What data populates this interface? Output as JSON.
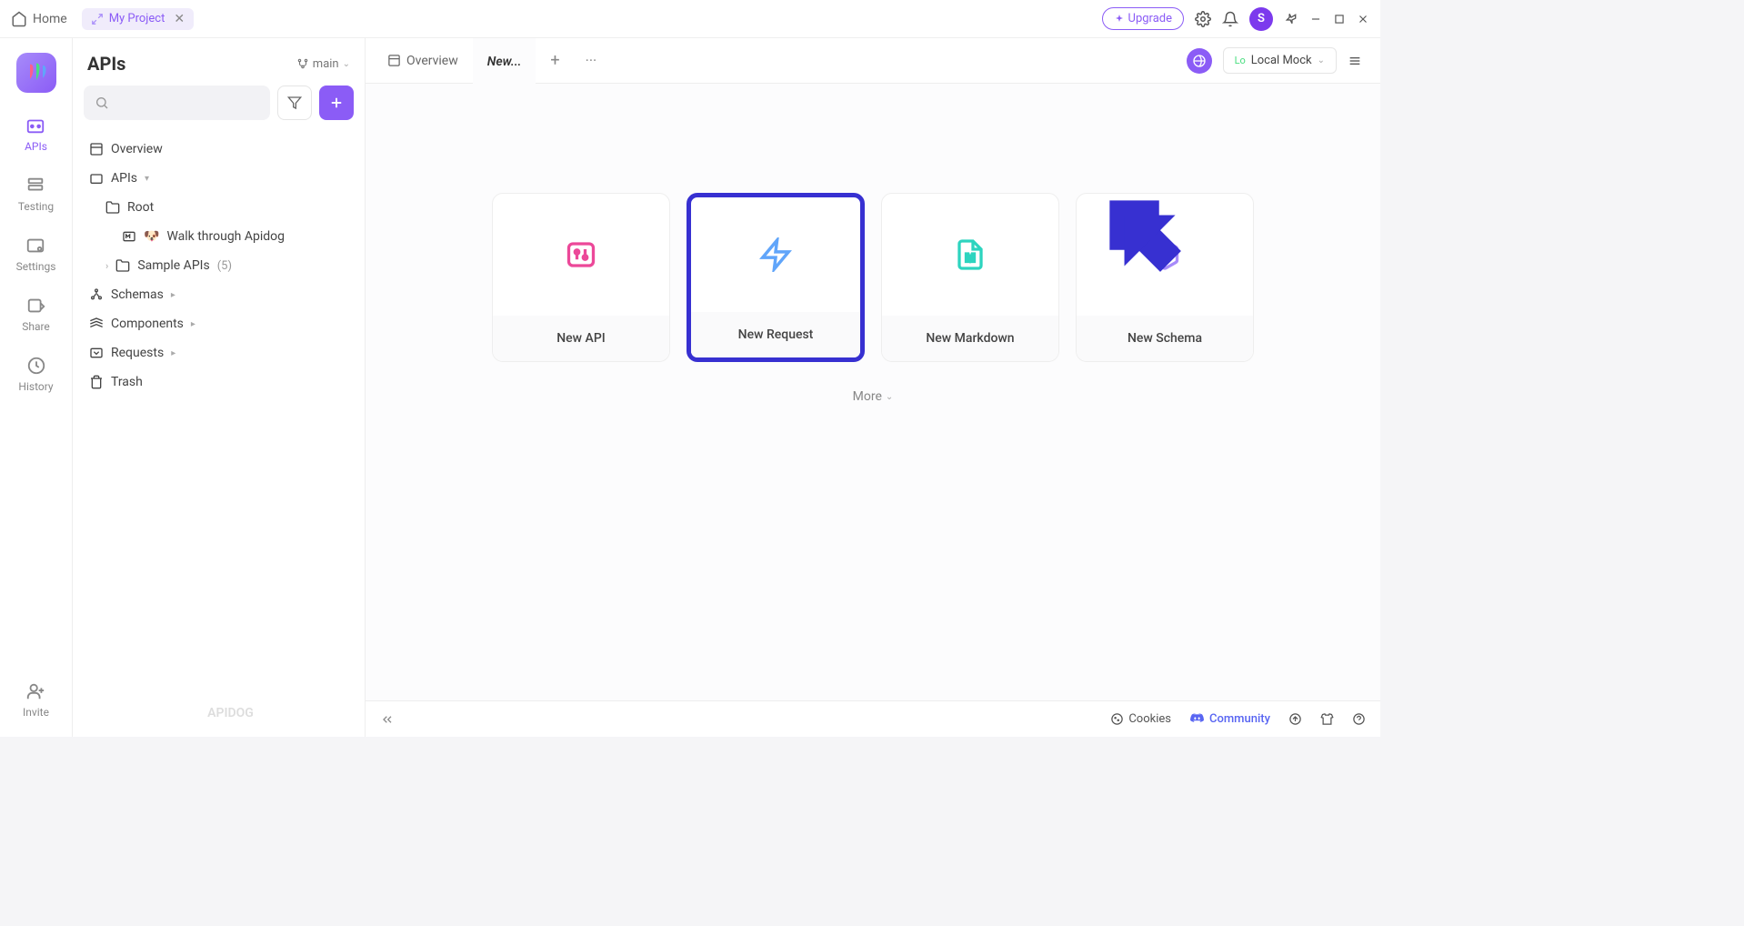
{
  "titlebar": {
    "home": "Home",
    "project_name": "My Project",
    "upgrade": "Upgrade",
    "avatar_initial": "S"
  },
  "rail": {
    "apis": "APIs",
    "testing": "Testing",
    "settings": "Settings",
    "share": "Share",
    "history": "History",
    "invite": "Invite"
  },
  "sidebar": {
    "title": "APIs",
    "branch": "main",
    "tree": {
      "overview": "Overview",
      "apis": "APIs",
      "root": "Root",
      "walk": "Walk through Apidog",
      "sample": "Sample APIs",
      "sample_count": "(5)",
      "schemas": "Schemas",
      "components": "Components",
      "requests": "Requests",
      "trash": "Trash"
    },
    "brand": "APIDOG"
  },
  "tabs": {
    "overview": "Overview",
    "new": "New...",
    "env_prefix": "Lo",
    "env": "Local Mock"
  },
  "cards": {
    "new_api": "New API",
    "new_request": "New Request",
    "new_markdown": "New Markdown",
    "new_schema": "New Schema",
    "more": "More"
  },
  "bottombar": {
    "cookies": "Cookies",
    "community": "Community"
  }
}
